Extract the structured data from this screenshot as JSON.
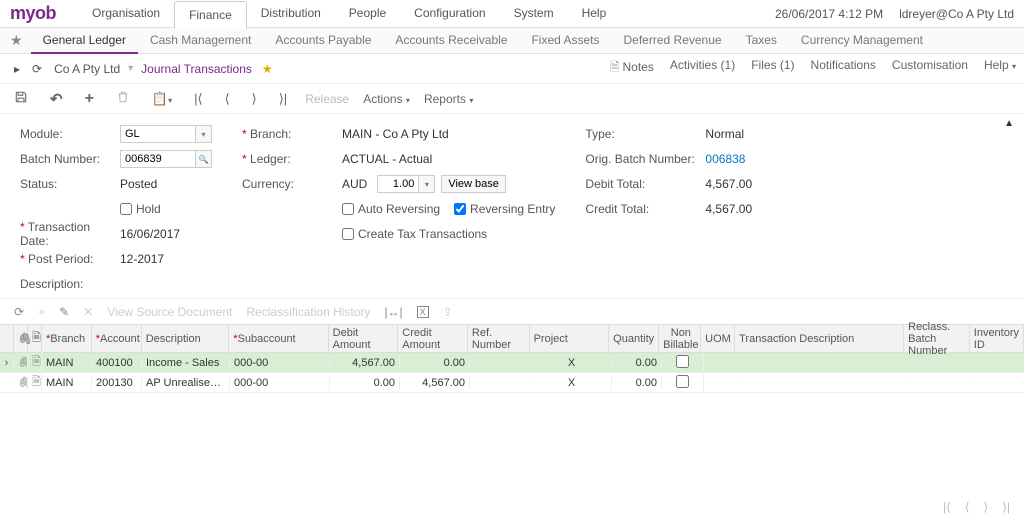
{
  "brand": "myob",
  "top_menu": [
    "Organisation",
    "Finance",
    "Distribution",
    "People",
    "Configuration",
    "System",
    "Help"
  ],
  "top_menu_active": "Finance",
  "datetime": "26/06/2017  4:12 PM",
  "user": "ldreyer@Co A Pty Ltd",
  "sub_nav": [
    "General Ledger",
    "Cash Management",
    "Accounts Payable",
    "Accounts Receivable",
    "Fixed Assets",
    "Deferred Revenue",
    "Taxes",
    "Currency Management"
  ],
  "sub_nav_active": "General Ledger",
  "path": {
    "company": "Co A Pty Ltd",
    "screen": "Journal Transactions"
  },
  "right_links": {
    "notes": "Notes",
    "activities": "Activities (1)",
    "files": "Files (1)",
    "notifications": "Notifications",
    "customisation": "Customisation",
    "help": "Help"
  },
  "toolbar": {
    "release": "Release",
    "actions": "Actions",
    "reports": "Reports"
  },
  "form": {
    "module_label": "Module:",
    "module": "GL",
    "batch_label": "Batch Number:",
    "batch": "006839",
    "status_label": "Status:",
    "status": "Posted",
    "hold_label": "Hold",
    "transdate_label": "Transaction Date:",
    "transdate": "16/06/2017",
    "postperiod_label": "Post Period:",
    "postperiod": "12-2017",
    "description_label": "Description:",
    "branch_label": "Branch:",
    "branch": "MAIN - Co A Pty Ltd",
    "ledger_label": "Ledger:",
    "ledger": "ACTUAL - Actual",
    "currency_label": "Currency:",
    "currency": "AUD",
    "rate": "1.00",
    "viewbase": "View base",
    "autorev": "Auto Reversing",
    "reventry": "Reversing Entry",
    "createtax": "Create Tax Transactions",
    "type_label": "Type:",
    "type": "Normal",
    "origbatch_label": "Orig. Batch Number:",
    "origbatch": "006838",
    "debittotal_label": "Debit Total:",
    "debittotal": "4,567.00",
    "credittotal_label": "Credit Total:",
    "credittotal": "4,567.00"
  },
  "grid_toolbar": {
    "viewsrc": "View Source Document",
    "reclass": "Reclassification History"
  },
  "grid": {
    "headers": {
      "branch": "Branch",
      "account": "Account",
      "description": "Description",
      "subaccount": "Subaccount",
      "debit": "Debit Amount",
      "credit": "Credit Amount",
      "ref": "Ref. Number",
      "project": "Project",
      "qty": "Quantity",
      "nonbill": "Non Billable",
      "uom": "UOM",
      "transdesc": "Transaction Description",
      "reclass": "Reclass. Batch Number",
      "inv": "Inventory ID"
    },
    "rows": [
      {
        "branch": "MAIN",
        "account": "400100",
        "description": "Income - Sales",
        "subaccount": "000-00",
        "debit": "4,567.00",
        "credit": "0.00",
        "ref": "",
        "project": "X",
        "qty": "0.00",
        "nonbill": false
      },
      {
        "branch": "MAIN",
        "account": "200130",
        "description": "AP Unrealised Gai…",
        "subaccount": "000-00",
        "debit": "0.00",
        "credit": "4,567.00",
        "ref": "",
        "project": "X",
        "qty": "0.00",
        "nonbill": false
      }
    ]
  }
}
